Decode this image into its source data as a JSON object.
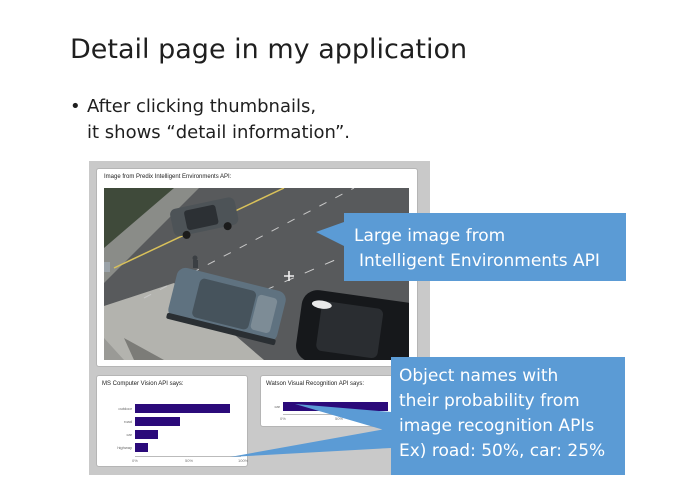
{
  "slide": {
    "title": "Detail page in my application",
    "bullet_line1": "After clicking thumbnails,",
    "bullet_line2": "it shows “detail information”."
  },
  "screenshot": {
    "image_caption": "Image from Predix Intelligent Environments API:",
    "ms_caption": "MS Computer Vision API says:",
    "watson_caption": "Watson Visual Recognition API says:",
    "ms_chart": {
      "categories": [
        "outdoor",
        "road",
        "car",
        "highway"
      ],
      "values": [
        0.9,
        0.42,
        0.22,
        0.12
      ],
      "ticks": [
        "0%",
        "50%",
        "100%"
      ]
    },
    "watson_chart": {
      "categories": [
        "car"
      ],
      "values": [
        0.95
      ],
      "ticks": [
        "0%",
        "50%"
      ]
    }
  },
  "callouts": {
    "large_image_line1": "Large image from",
    "large_image_line2": "Intelligent Environments API",
    "objects_line1": "Object names with",
    "objects_line2": "their probability from",
    "objects_line3": "image recognition APIs",
    "objects_line4": "Ex) road: 50%, car: 25%"
  },
  "colors": {
    "callout_fill": "#5b9bd5",
    "bar_fill": "#2b0a7a"
  }
}
